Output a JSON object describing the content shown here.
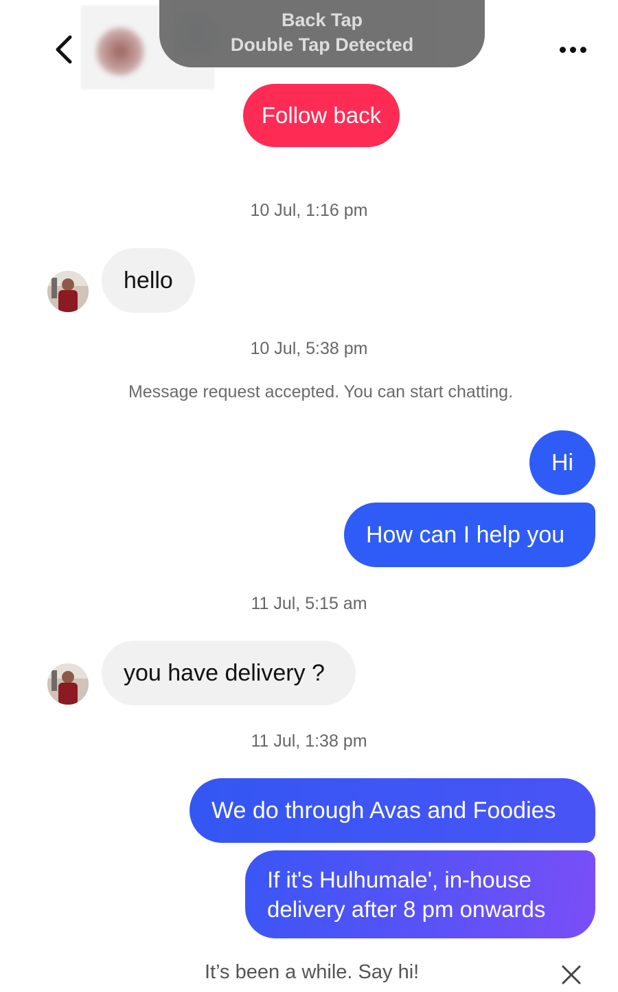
{
  "header": {
    "back_icon": "chevron-left-icon",
    "more_icon": "ellipsis-horizontal-icon",
    "toast": {
      "line1": "Back Tap",
      "line2": "Double Tap Detected"
    },
    "follow_back_label": "Follow back"
  },
  "conversation": {
    "timestamps": [
      "10 Jul, 1:16 pm",
      "10 Jul, 5:38 pm",
      "11 Jul, 5:15 am",
      "11 Jul, 1:38 pm"
    ],
    "system_notice": "Message request accepted. You can start chatting.",
    "messages": [
      {
        "from": "them",
        "text": "hello"
      },
      {
        "from": "me",
        "text": "Hi"
      },
      {
        "from": "me",
        "text": "How can I help you"
      },
      {
        "from": "them",
        "text": "you have delivery ?"
      },
      {
        "from": "me",
        "text": "We do through Avas and Foodies"
      },
      {
        "from": "me",
        "text": "If it's Hulhumale', in-house delivery after 8 pm onwards"
      }
    ]
  },
  "footer": {
    "hint": "It’s been a while. Say hi!",
    "close_icon": "close-icon"
  },
  "colors": {
    "follow_button": "#fe2c55",
    "outgoing_bubble": "#2f5cf6",
    "outgoing_bubble_gradient_end": "#7b4ef7",
    "incoming_bubble": "#f1f1f1"
  }
}
